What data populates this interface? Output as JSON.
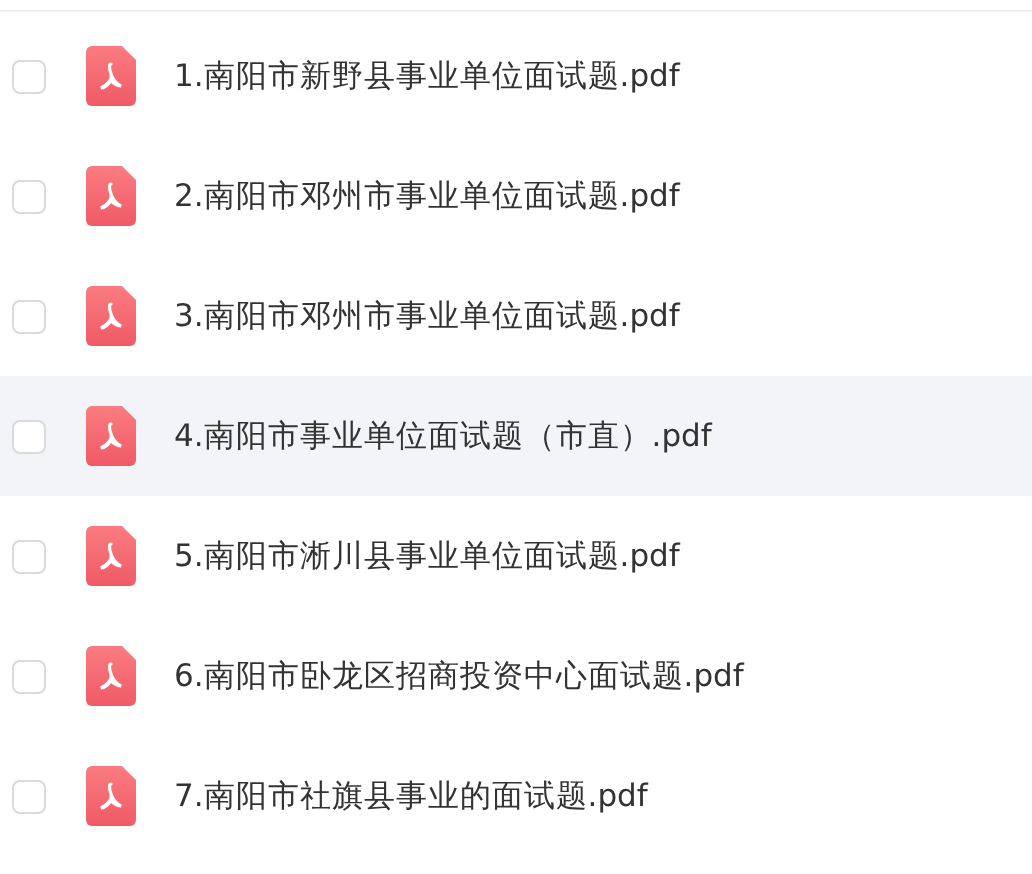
{
  "files": [
    {
      "name": "1.南阳市新野县事业单位面试题.pdf",
      "checked": false,
      "highlighted": false
    },
    {
      "name": "2.南阳市邓州市事业单位面试题.pdf",
      "checked": false,
      "highlighted": false
    },
    {
      "name": "3.南阳市邓州市事业单位面试题.pdf",
      "checked": false,
      "highlighted": false
    },
    {
      "name": "4.南阳市事业单位面试题（市直）.pdf",
      "checked": false,
      "highlighted": true
    },
    {
      "name": "5.南阳市淅川县事业单位面试题.pdf",
      "checked": false,
      "highlighted": false
    },
    {
      "name": "6.南阳市卧龙区招商投资中心面试题.pdf",
      "checked": false,
      "highlighted": false
    },
    {
      "name": "7.南阳市社旗县事业的面试题.pdf",
      "checked": false,
      "highlighted": false
    }
  ]
}
